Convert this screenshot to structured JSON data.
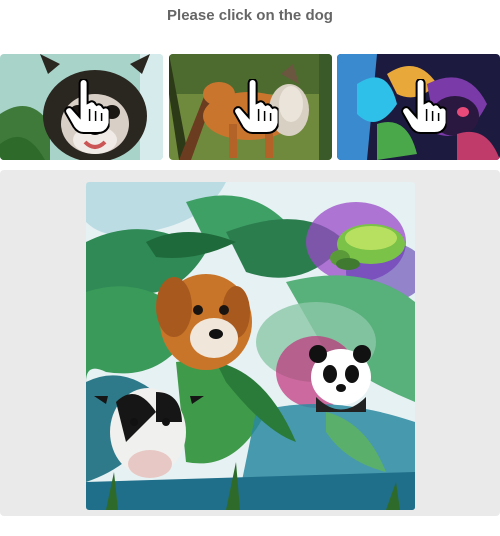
{
  "prompt": {
    "text": "Please click on the dog"
  },
  "thumbnails": [
    {
      "icon": "pointer-hand-icon",
      "colors": [
        "#2b3a28",
        "#8ad0d0",
        "#e8e0d8"
      ]
    },
    {
      "icon": "pointer-hand-icon",
      "colors": [
        "#5a7a2a",
        "#c0692d",
        "#d8c8b0"
      ]
    },
    {
      "icon": "pointer-hand-icon",
      "colors": [
        "#1a1a40",
        "#2ea8e8",
        "#8a3aa8"
      ]
    }
  ],
  "main_image": {
    "colors": {
      "jungle": "#2f8a55",
      "sky": "#e8f2f4",
      "dog": "#c8752a",
      "cow": "#f0f0ee",
      "panda": "#ffffff",
      "turtle": "#7ac248"
    }
  },
  "footer": {
    "left_text": "",
    "right_text": ""
  }
}
